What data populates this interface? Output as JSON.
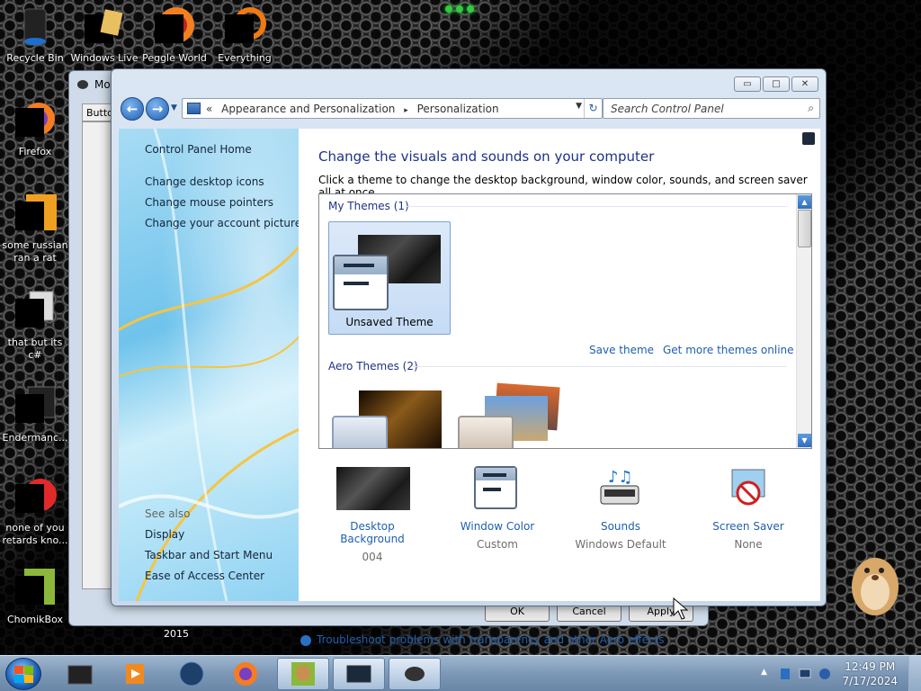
{
  "desktop": {
    "icons": [
      {
        "label": "Recycle Bin"
      },
      {
        "label": "Windows Live"
      },
      {
        "label": "Peggle World"
      },
      {
        "label": "Everything"
      },
      {
        "label": "Firefox"
      },
      {
        "label": "some russian ran a rat"
      },
      {
        "label": "that but its c#"
      },
      {
        "label": "Endermanc..."
      },
      {
        "label": "none of you retards kno..."
      },
      {
        "label": "ChomikBox"
      }
    ]
  },
  "back_window": {
    "title": "Mo",
    "tab_label": "Butto",
    "buttons": [
      "OK",
      "Cancel",
      "Apply"
    ],
    "year_label": "2015"
  },
  "window": {
    "caption": {
      "minimize": "▭",
      "maximize": "□",
      "close": "✕"
    },
    "nav": {
      "back": "←",
      "forward": "→"
    },
    "address": {
      "prefix": "«",
      "crumbs": [
        "Appearance and Personalization",
        "▸",
        "Personalization"
      ]
    },
    "search": {
      "placeholder": "Search Control Panel"
    },
    "left_pane": {
      "home": "Control Panel Home",
      "links": [
        "Change desktop icons",
        "Change mouse pointers",
        "Change your account picture"
      ],
      "see_also": "See also",
      "see_also_links": [
        "Display",
        "Taskbar and Start Menu",
        "Ease of Access Center"
      ]
    },
    "content": {
      "heading": "Change the visuals and sounds on your computer",
      "subheading": "Click a theme to change the desktop background, window color, sounds, and screen saver all at once.",
      "my_themes_header": "My Themes (1)",
      "unsaved_theme": "Unsaved Theme",
      "save_theme": "Save theme",
      "get_more": "Get more themes online",
      "aero_themes_header": "Aero Themes (2)",
      "items": [
        {
          "label": "Desktop Background",
          "value": "004"
        },
        {
          "label": "Window Color",
          "value": "Custom"
        },
        {
          "label": "Sounds",
          "value": "Windows Default"
        },
        {
          "label": "Screen Saver",
          "value": "None"
        }
      ],
      "troubleshoot": "Troubleshoot problems with transparency and other Aero effects"
    }
  },
  "taskbar": {
    "clock_time": "12:49 PM",
    "clock_date": "7/17/2024",
    "tray_arrow": "▲",
    "pinned": [
      "terminal",
      "media-player",
      "globe",
      "firefox",
      "chomikbox",
      "display",
      "mouse"
    ]
  },
  "colors": {
    "link": "#1e5fb0",
    "heading": "#1e3287",
    "taskbar": "#7d98b6"
  }
}
